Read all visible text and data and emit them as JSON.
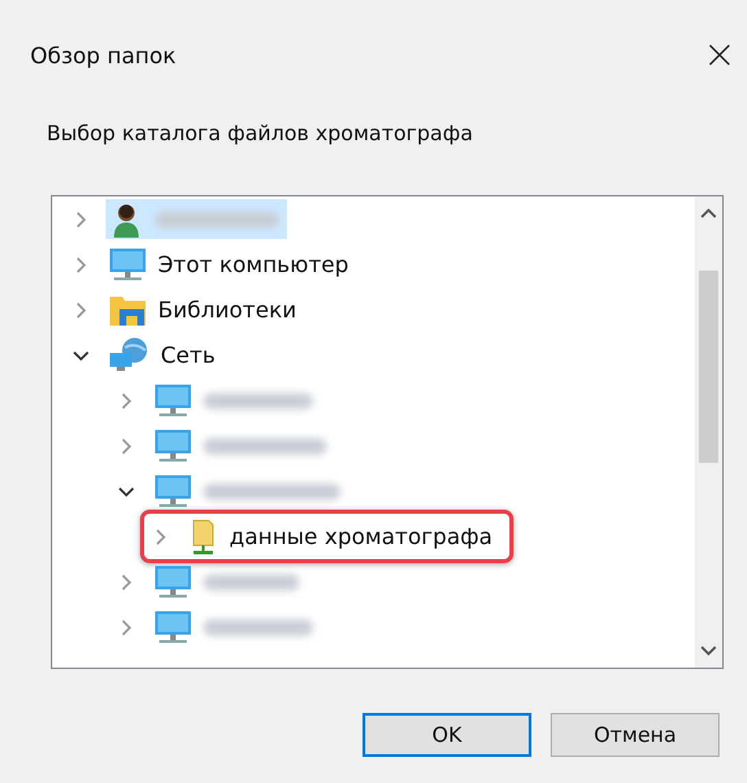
{
  "window": {
    "title": "Обзор папок"
  },
  "prompt": "Выбор каталога файлов хроматографа",
  "tree": [
    {
      "kind": "user",
      "redacted": true,
      "selected": true,
      "expanded": false,
      "highlighted": false
    },
    {
      "kind": "computer",
      "label": "Этот компьютер",
      "selected": false,
      "expanded": false,
      "highlighted": false
    },
    {
      "kind": "library",
      "label": "Библиотеки",
      "selected": false,
      "expanded": false,
      "highlighted": false
    },
    {
      "kind": "network",
      "label": "Сеть",
      "selected": false,
      "expanded": true,
      "highlighted": false,
      "children": [
        {
          "kind": "computer",
          "redacted": true,
          "selected": false,
          "expanded": false,
          "highlighted": false
        },
        {
          "kind": "computer",
          "redacted": true,
          "selected": false,
          "expanded": false,
          "highlighted": false
        },
        {
          "kind": "computer",
          "redacted": true,
          "selected": false,
          "expanded": true,
          "highlighted": false,
          "children": [
            {
              "kind": "share",
              "label": "данные хроматографа",
              "selected": false,
              "expanded": false,
              "highlighted": true
            }
          ]
        },
        {
          "kind": "computer",
          "redacted": true,
          "selected": false,
          "expanded": false,
          "highlighted": false
        },
        {
          "kind": "computer",
          "redacted": true,
          "selected": false,
          "expanded": false,
          "highlighted": false
        }
      ]
    }
  ],
  "buttons": [
    {
      "label": "OK",
      "default": true
    },
    {
      "label": "Отмена",
      "default": false
    }
  ]
}
